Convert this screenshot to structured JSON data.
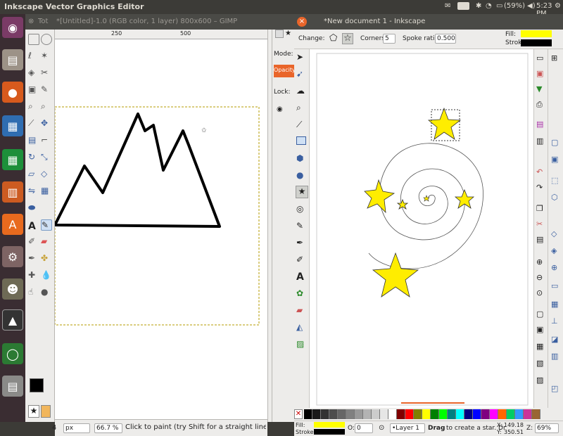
{
  "top_panel": {
    "app_title": "Inkscape Vector Graphics Editor",
    "input_lang": "En",
    "battery": "(59%)",
    "clock": "5:23 PM"
  },
  "gimp": {
    "tab_title": "Tot",
    "title": "*[Untitled]-1.0 (RGB color, 1 layer) 800x600 – GIMP",
    "ruler_marks": [
      "250",
      "500"
    ],
    "mode_label": "Mode:",
    "opacity_label": "Opacity",
    "lock_label": "Lock:",
    "status_unit": "px",
    "status_zoom": "66.7 %",
    "status_msg": "Click to paint (try Shift for a straight line, Ctrl to ...",
    "status_left": "4"
  },
  "inkscape": {
    "title": "*New document 1 - Inkscape",
    "change_label": "Change:",
    "corners_label": "Corners:",
    "corners_value": "5",
    "spoke_label": "Spoke ratio:",
    "spoke_value": "0.500",
    "fill_label": "Fill:",
    "stroke_label": "Stroke:",
    "status_fill": "Fill:",
    "status_stroke": "Stroke:",
    "opacity_value": "0",
    "layer_label": "•Layer 1",
    "status_msg_bold": "Drag",
    "status_msg": "to create a star. Dr",
    "x_label": "X:",
    "x_value": "149.18",
    "y_label": "Y:",
    "y_value": "350.51",
    "z_label": "Z:",
    "zoom_value": "69%",
    "fill_color": "#ffff00",
    "stroke_color": "#000000"
  },
  "launcher": {
    "items": [
      "ubuntu-icon",
      "files-icon",
      "firefox-icon",
      "writer-icon",
      "calc-icon",
      "impress-icon",
      "software-icon",
      "settings-icon",
      "gimp-icon",
      "inkscape-icon",
      "update-icon",
      "workspaces-icon"
    ]
  }
}
